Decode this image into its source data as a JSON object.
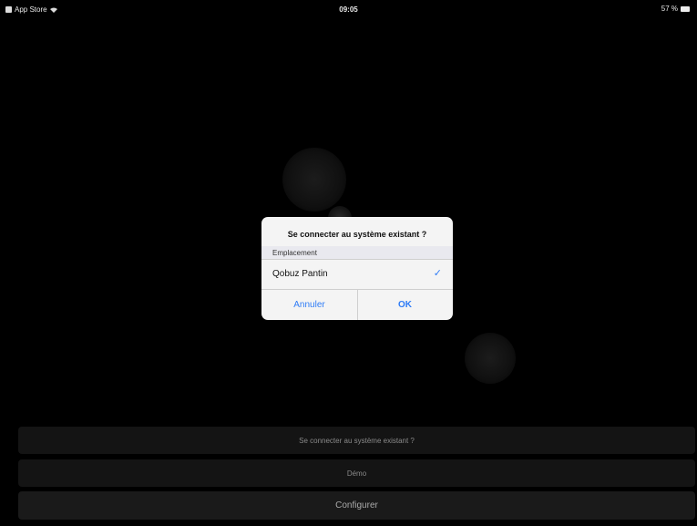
{
  "status_bar": {
    "back_app": "App Store",
    "time": "09:05",
    "battery": "57 %"
  },
  "dialog": {
    "title": "Se connecter au système existant ?",
    "section_header": "Emplacement",
    "selected_location": "Qobuz Pantin",
    "cancel_label": "Annuler",
    "ok_label": "OK",
    "accent_color": "#2f7cf6"
  },
  "actions": {
    "connect_label": "Se connecter au système existant ?",
    "demo_label": "Démo",
    "configure_label": "Configurer"
  }
}
